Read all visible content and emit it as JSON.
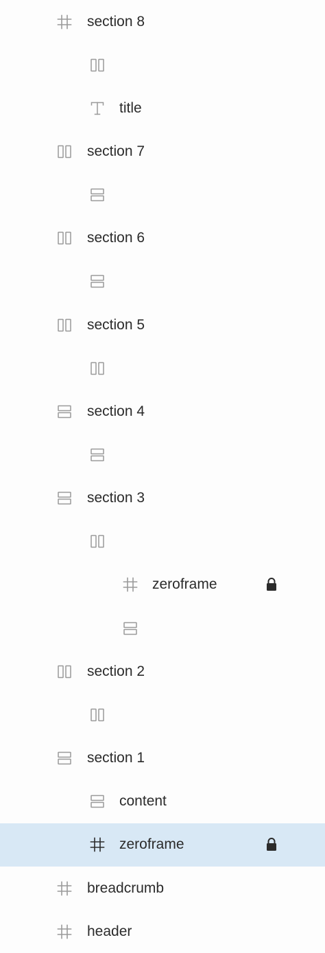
{
  "layers": [
    {
      "level": 0,
      "icon": "frame-icon",
      "label": "section 8",
      "locked": false,
      "selected": false
    },
    {
      "level": 1,
      "icon": "columns-icon",
      "label": "",
      "locked": false,
      "selected": false
    },
    {
      "level": 1,
      "icon": "text-icon",
      "label": "title",
      "locked": false,
      "selected": false
    },
    {
      "level": 0,
      "icon": "columns-icon",
      "label": "section 7",
      "locked": false,
      "selected": false
    },
    {
      "level": 1,
      "icon": "rows-icon",
      "label": "",
      "locked": false,
      "selected": false
    },
    {
      "level": 0,
      "icon": "columns-icon",
      "label": "section 6",
      "locked": false,
      "selected": false
    },
    {
      "level": 1,
      "icon": "rows-icon",
      "label": "",
      "locked": false,
      "selected": false
    },
    {
      "level": 0,
      "icon": "columns-icon",
      "label": "section 5",
      "locked": false,
      "selected": false
    },
    {
      "level": 1,
      "icon": "columns-icon",
      "label": "",
      "locked": false,
      "selected": false
    },
    {
      "level": 0,
      "icon": "rows-icon",
      "label": "section 4",
      "locked": false,
      "selected": false
    },
    {
      "level": 1,
      "icon": "rows-icon",
      "label": "",
      "locked": false,
      "selected": false
    },
    {
      "level": 0,
      "icon": "rows-icon",
      "label": "section 3",
      "locked": false,
      "selected": false
    },
    {
      "level": 1,
      "icon": "columns-icon",
      "label": "",
      "locked": false,
      "selected": false
    },
    {
      "level": 2,
      "icon": "frame-icon",
      "label": "zeroframe",
      "locked": true,
      "selected": false
    },
    {
      "level": 2,
      "icon": "rows-icon",
      "label": "",
      "locked": false,
      "selected": false
    },
    {
      "level": 0,
      "icon": "columns-icon",
      "label": "section 2",
      "locked": false,
      "selected": false
    },
    {
      "level": 1,
      "icon": "columns-icon",
      "label": "",
      "locked": false,
      "selected": false
    },
    {
      "level": 0,
      "icon": "rows-icon",
      "label": "section 1",
      "locked": false,
      "selected": false
    },
    {
      "level": 1,
      "icon": "rows-icon",
      "label": "content",
      "locked": false,
      "selected": false
    },
    {
      "level": 1,
      "icon": "frame-icon",
      "label": "zeroframe",
      "locked": true,
      "selected": true
    },
    {
      "level": 0,
      "icon": "frame-icon",
      "label": "breadcrumb",
      "locked": false,
      "selected": false
    },
    {
      "level": 0,
      "icon": "frame-icon",
      "label": "header",
      "locked": false,
      "selected": false
    }
  ],
  "colors": {
    "selected_bg": "#d8e8f5",
    "icon_muted": "#9a9a9a",
    "icon_dark": "#2b2b2b",
    "text": "#2b2b2b"
  }
}
